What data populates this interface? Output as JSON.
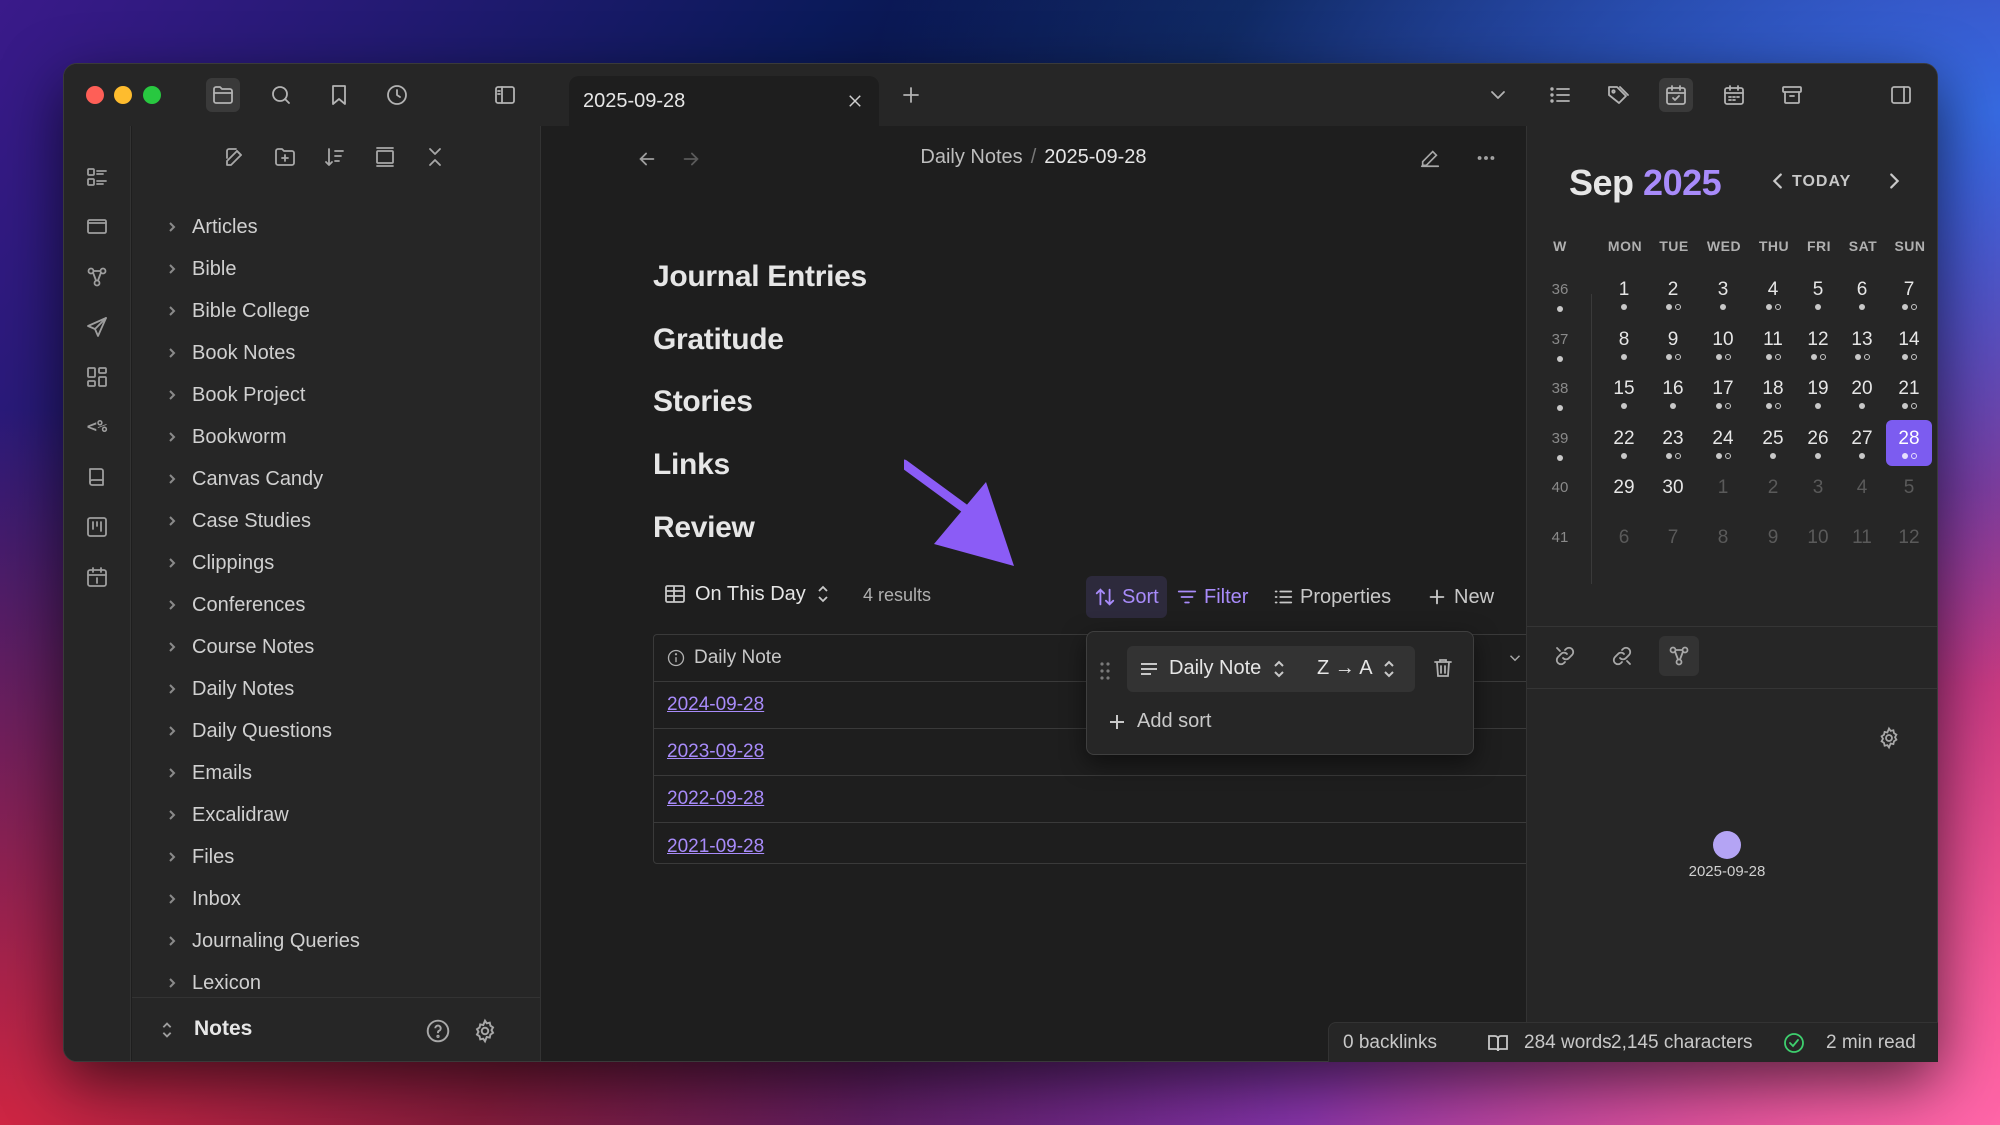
{
  "window": {
    "tab_title": "2025-09-28"
  },
  "breadcrumb": {
    "folder": "Daily Notes",
    "separator": "/",
    "current": "2025-09-28"
  },
  "explorer": {
    "folders": [
      "Articles",
      "Bible",
      "Bible College",
      "Book Notes",
      "Book Project",
      "Bookworm",
      "Canvas Candy",
      "Case Studies",
      "Clippings",
      "Conferences",
      "Course Notes",
      "Daily Notes",
      "Daily Questions",
      "Emails",
      "Excalidraw",
      "Files",
      "Inbox",
      "Journaling Queries",
      "Lexicon"
    ],
    "vault_name": "Notes"
  },
  "ribbon": {
    "templater_label": "<%"
  },
  "note": {
    "headings": [
      "Journal Entries",
      "Gratitude",
      "Stories",
      "Links",
      "Review"
    ]
  },
  "base": {
    "view_name": "On This Day",
    "results": "4 results",
    "sort_label": "Sort",
    "filter_label": "Filter",
    "properties_label": "Properties",
    "new_label": "New",
    "column_header": "Daily Note",
    "rows": [
      "2024-09-28",
      "2023-09-28",
      "2022-09-28",
      "2021-09-28"
    ]
  },
  "sort_popup": {
    "property": "Daily Note",
    "direction": "Z → A",
    "add_sort_label": "Add sort"
  },
  "calendar": {
    "month": "Sep",
    "year": "2025",
    "today_label": "TODAY",
    "weekday_headers": [
      "W",
      "MON",
      "TUE",
      "WED",
      "THU",
      "FRI",
      "SAT",
      "SUN"
    ],
    "weeks": [
      {
        "num": "36",
        "days": [
          "1",
          "2",
          "3",
          "4",
          "5",
          "6",
          "7"
        ]
      },
      {
        "num": "37",
        "days": [
          "8",
          "9",
          "10",
          "11",
          "12",
          "13",
          "14"
        ]
      },
      {
        "num": "38",
        "days": [
          "15",
          "16",
          "17",
          "18",
          "19",
          "20",
          "21"
        ]
      },
      {
        "num": "39",
        "days": [
          "22",
          "23",
          "24",
          "25",
          "26",
          "27",
          "28"
        ]
      },
      {
        "num": "40",
        "days": [
          "29",
          "30",
          "1",
          "2",
          "3",
          "4",
          "5"
        ]
      },
      {
        "num": "41",
        "days": [
          "6",
          "7",
          "8",
          "9",
          "10",
          "11",
          "12"
        ]
      }
    ],
    "selected_day": "28"
  },
  "graph": {
    "node_label": "2025-09-28"
  },
  "status": {
    "backlinks": "0 backlinks",
    "words": "284 words",
    "characters": "2,145 characters",
    "read_time": "2 min read"
  },
  "colors": {
    "accent": "#a88bfa",
    "selected_day": "#7c5cf0",
    "annotation_arrow": "#8b5cf6"
  }
}
